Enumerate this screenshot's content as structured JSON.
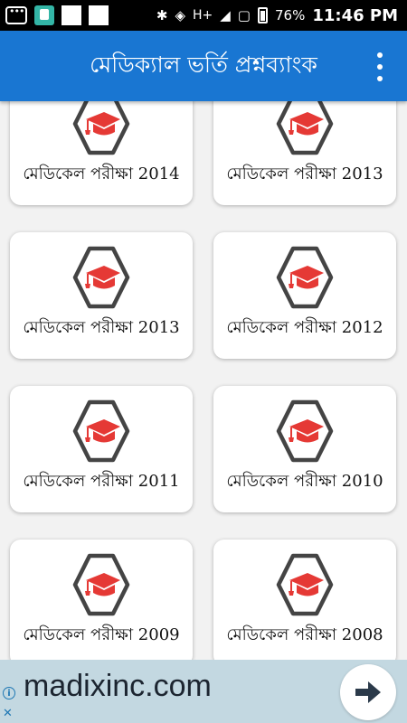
{
  "status_bar": {
    "signal": "H+",
    "battery": "76%",
    "time": "11:46 PM"
  },
  "app_bar": {
    "title": "মেডিক্যাল ভর্তি প্রশ্নব্যাংক"
  },
  "cards": [
    {
      "label": "মেডিকেল পরীক্ষা 2014",
      "icon": "graduation-cap-icon"
    },
    {
      "label": "মেডিকেল পরীক্ষা 2013",
      "icon": "graduation-cap-icon"
    },
    {
      "label": "মেডিকেল পরীক্ষা 2013",
      "icon": "graduation-cap-icon"
    },
    {
      "label": "মেডিকেল পরীক্ষা 2012",
      "icon": "graduation-cap-icon"
    },
    {
      "label": "মেডিকেল পরীক্ষা 2011",
      "icon": "graduation-cap-icon"
    },
    {
      "label": "মেডিকেল পরীক্ষা 2010",
      "icon": "graduation-cap-icon"
    },
    {
      "label": "মেডিকেল পরীক্ষা 2009",
      "icon": "graduation-cap-icon"
    },
    {
      "label": "মেডিকেল পরীক্ষা 2008",
      "icon": "graduation-cap-icon"
    }
  ],
  "ad": {
    "text": "madixinc.com",
    "info": "i",
    "close": "✕"
  },
  "colors": {
    "primary": "#1976d2",
    "cap_red": "#e53935",
    "hex_border": "#444444",
    "ad_bg": "#c3d8e1"
  }
}
